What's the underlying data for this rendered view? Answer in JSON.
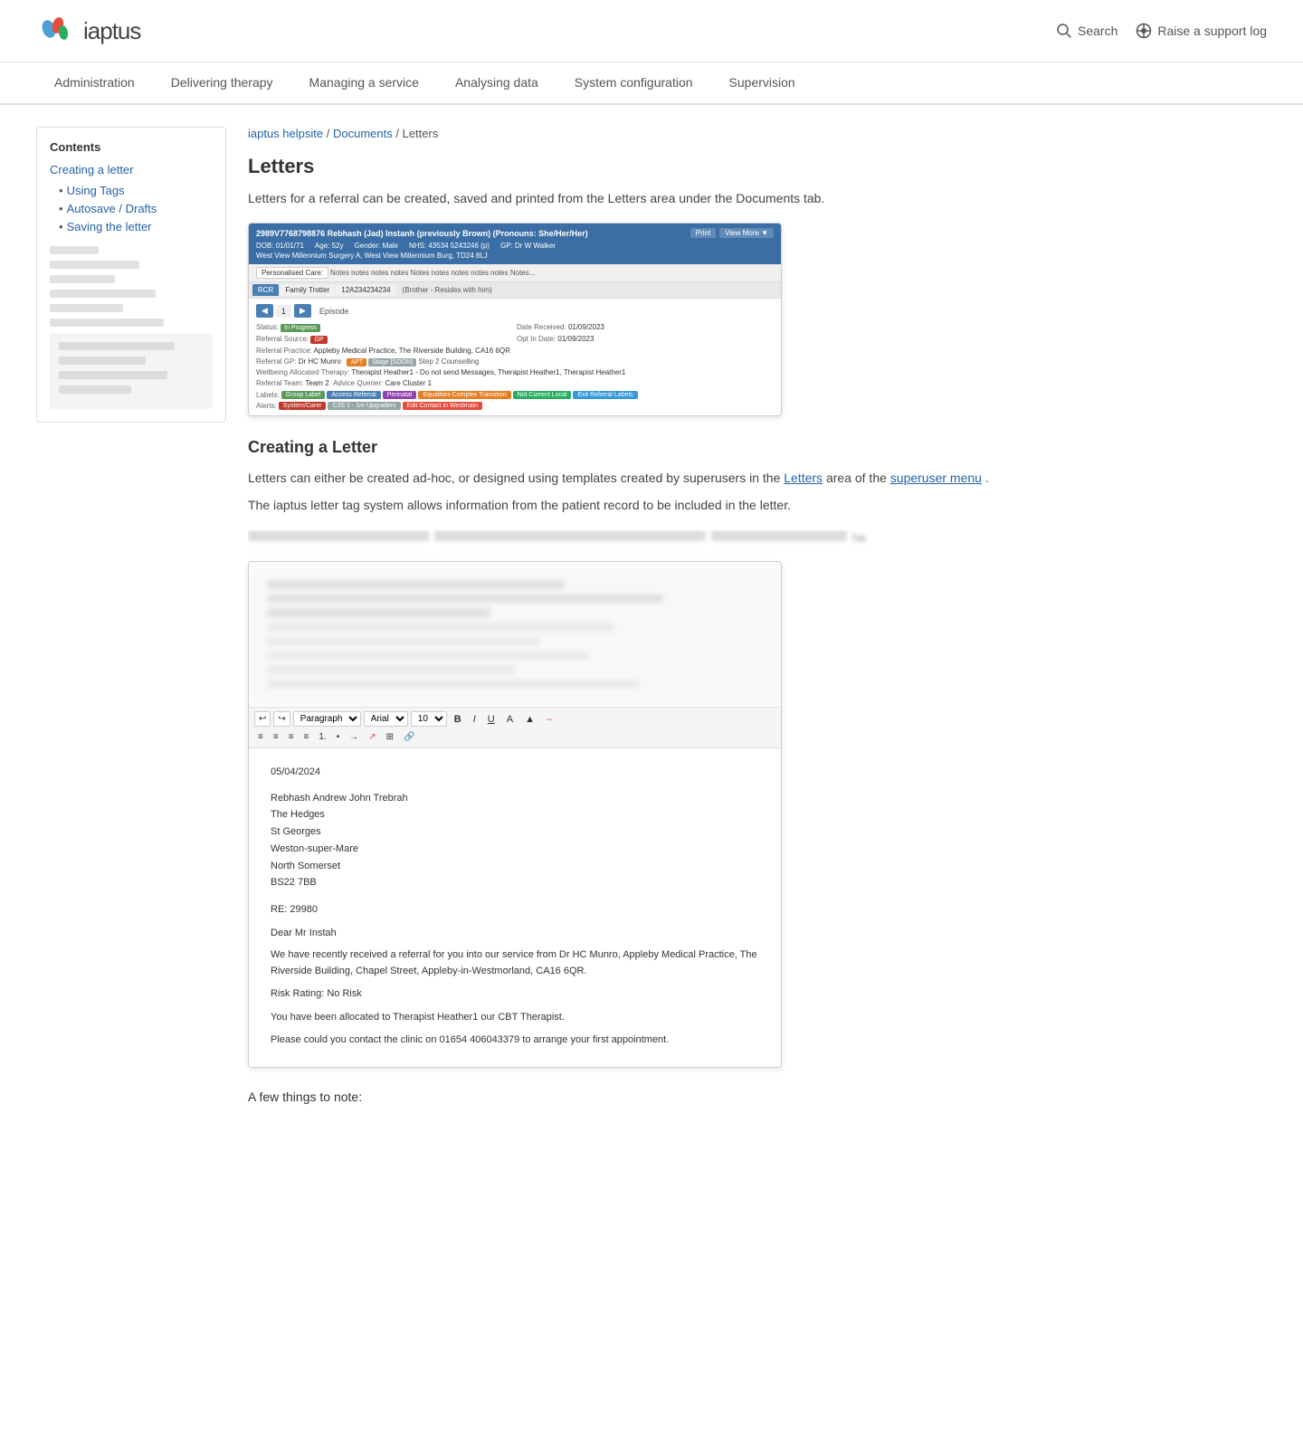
{
  "header": {
    "logo_text": "iaptus",
    "search_label": "Search",
    "support_label": "Raise a support log"
  },
  "nav": {
    "items": [
      {
        "label": "Administration",
        "id": "admin"
      },
      {
        "label": "Delivering therapy",
        "id": "delivering"
      },
      {
        "label": "Managing a service",
        "id": "managing"
      },
      {
        "label": "Analysing data",
        "id": "analysing"
      },
      {
        "label": "System configuration",
        "id": "system-config"
      },
      {
        "label": "Supervision",
        "id": "supervision"
      }
    ]
  },
  "sidebar": {
    "title": "Contents",
    "main_link": "Creating a letter",
    "sub_links": [
      {
        "label": "Using Tags"
      },
      {
        "label": "Autosave / Drafts"
      },
      {
        "label": "Saving the letter"
      }
    ]
  },
  "breadcrumb": {
    "home": "iaptus helpsite",
    "separator1": " / ",
    "docs": "Documents",
    "separator2": " / ",
    "current": "Letters"
  },
  "page": {
    "title": "Letters",
    "description": "Letters for a referral can be created, saved and printed from the Letters area under the Documents tab.",
    "section1_title": "Creating a Letter",
    "section1_text1": "Letters can either be created ad-hoc, or designed using templates created by superusers in the",
    "section1_link1": "Letters",
    "section1_text2": "area of the",
    "section1_link2": "superuser menu",
    "section1_text3": ".",
    "section1_text4": "The iaptus letter tag system allows information from the patient record to be included in the letter.",
    "note_heading": "A few things to note:"
  },
  "patient_record": {
    "name": "2989V7768798876 Rebhash (Jad) Instanh (previously Brown) (Pronouns: She/Her/Her)",
    "dob": "01/01/71",
    "age": "52y",
    "gender": "Male",
    "nhs": "43534 5243246 (p)",
    "gp": "Dr W Walker",
    "practice": "West View Millennium Surgery A, West View Millennium Burg, TD24 8LJ",
    "rcr": "12A234234234",
    "episode_status": "In Progress",
    "date_received": "01/09/2023",
    "opt_in": "01/09/2023"
  },
  "letter_editor": {
    "date": "05/04/2024",
    "addressee_name": "Rebhash Andrew John Trebrah",
    "address_line1": "The Hedges",
    "address_line2": "St Georges",
    "address_line3": "Weston-super-Mare",
    "address_line4": "North Somerset",
    "address_line5": "BS22 7BB",
    "re": "RE: 29980",
    "salutation": "Dear Mr Instah",
    "body1": "We have recently received a referral for you into our service from Dr HC Munro, Appleby Medical Practice, The Riverside Building, Chapel Street, Appleby-in-Westmorland, CA16 6QR.",
    "risk": "Risk Rating: No Risk",
    "allocation": "You have been allocated to Therapist Heather1 our CBT Therapist.",
    "contact": "Please could you contact the clinic on 01654 406043379 to arrange your first appointment."
  }
}
